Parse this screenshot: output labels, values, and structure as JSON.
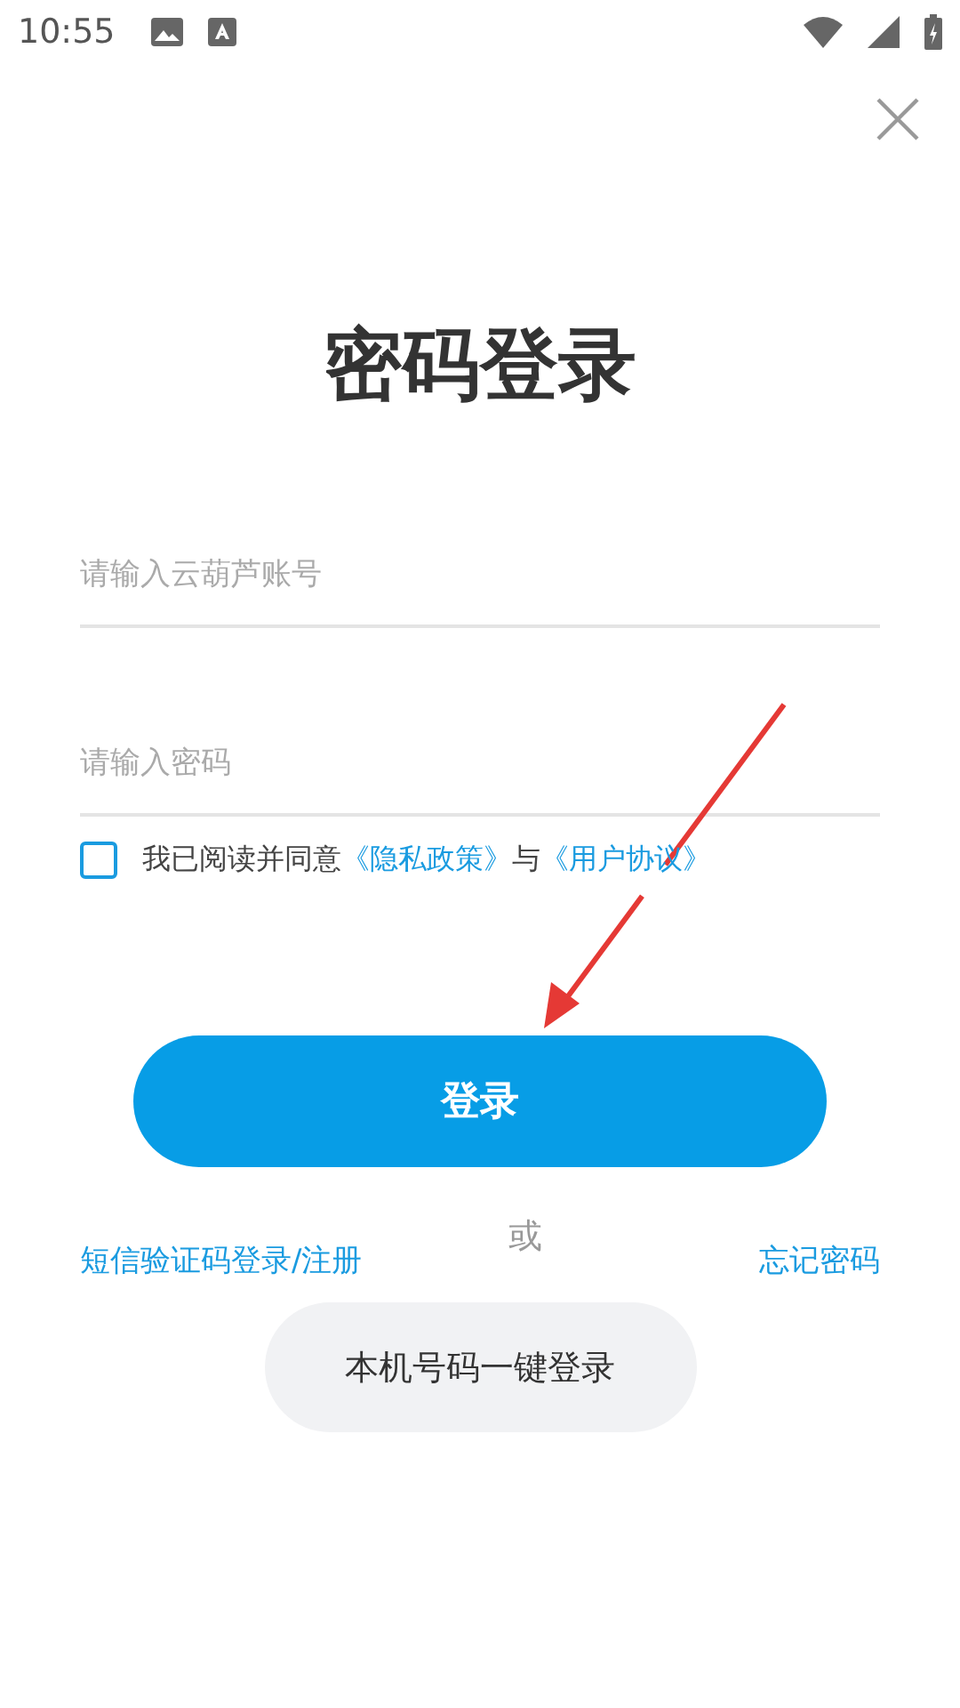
{
  "status_bar": {
    "time": "10:55"
  },
  "title": "密码登录",
  "account_field": {
    "placeholder": "请输入云葫芦账号"
  },
  "password_field": {
    "placeholder": "请输入密码"
  },
  "agreement": {
    "checked": false,
    "text": "我已阅读并同意",
    "privacy_link": "《隐私政策》",
    "joiner": "与",
    "terms_link": "《用户协议》"
  },
  "login_button": "登录",
  "sms_login_link": "短信验证码登录/注册",
  "or_label": "或",
  "forgot_password_link": "忘记密码",
  "one_tap_button": "本机号码一键登录"
}
